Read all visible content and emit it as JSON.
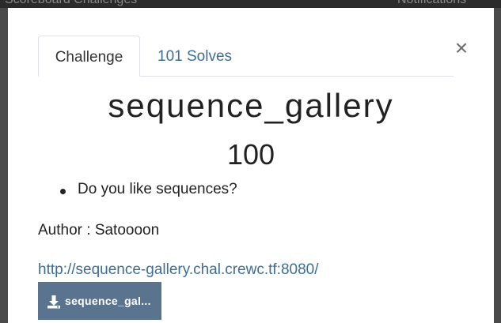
{
  "background": {
    "left_text": "Scoreboard    Challenges",
    "right_text": "Notifications"
  },
  "tabs": [
    {
      "label": "Challenge",
      "active": true
    },
    {
      "label": "101 Solves",
      "active": false
    }
  ],
  "close_symbol": "×",
  "challenge": {
    "name": "sequence_gallery",
    "points": "100",
    "description_items": [
      "Do you like sequences?"
    ],
    "author": "Author : Satoooon",
    "link": "http://sequence-gallery.chal.crewc.tf:8080/",
    "file_label": "sequence_gal..."
  },
  "colors": {
    "link": "#3e6d94",
    "file_button": "#5a7490"
  }
}
